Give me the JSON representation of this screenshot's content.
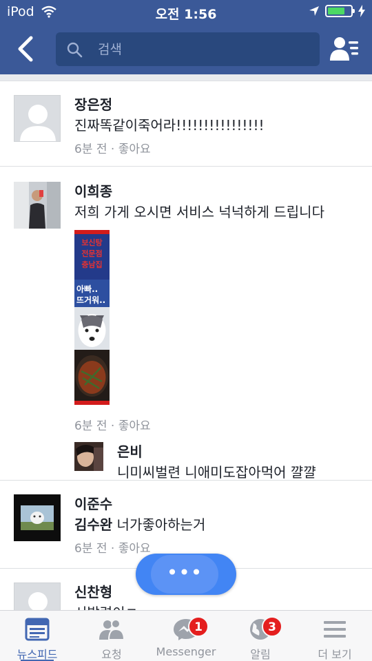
{
  "status_bar": {
    "carrier": "iPod",
    "time": "오전 1:56",
    "battery_level": 0.75
  },
  "search": {
    "placeholder": "검색"
  },
  "comments": [
    {
      "name": "장은정",
      "text": "진짜똑같이죽어라!!!!!!!!!!!!!!!!",
      "time": "6분 전",
      "separator": " · ",
      "like": "좋아요"
    },
    {
      "name": "이희종",
      "text": "저희 가게 오시면 서비스 넉넉하게 드립니다",
      "photo_caption_top": "보신탕 전문점 충남집",
      "photo_caption_mid": "아빠.. 뜨거워..",
      "time": "6분 전",
      "separator": " · ",
      "like": "좋아요",
      "reply": {
        "name": "은비",
        "text": "니미씨벌련 니애미도잡아먹어 꺌꺌"
      }
    },
    {
      "name": "이준수",
      "tag": "김수완",
      "text": " 너가좋아하는거",
      "time": "6분 전",
      "separator": " · ",
      "like": "좋아요"
    },
    {
      "name": "신찬형",
      "text": "시발련이ㅋ·"
    }
  ],
  "chat_head": {
    "dots": "•••"
  },
  "tabs": [
    {
      "label": "뉴스피드",
      "icon": "news-feed-icon",
      "active": true
    },
    {
      "label": "요청",
      "icon": "friend-requests-icon"
    },
    {
      "label": "Messenger",
      "icon": "messenger-icon",
      "badge": "1"
    },
    {
      "label": "알림",
      "icon": "notifications-globe-icon",
      "badge": "3"
    },
    {
      "label": "더 보기",
      "icon": "menu-icon"
    }
  ],
  "colors": {
    "brand_blue": "#3b5998",
    "search_bg": "#29487d",
    "active_tab": "#4267b2",
    "badge_red": "#e41e1e",
    "chat_head": "#4285f4"
  }
}
